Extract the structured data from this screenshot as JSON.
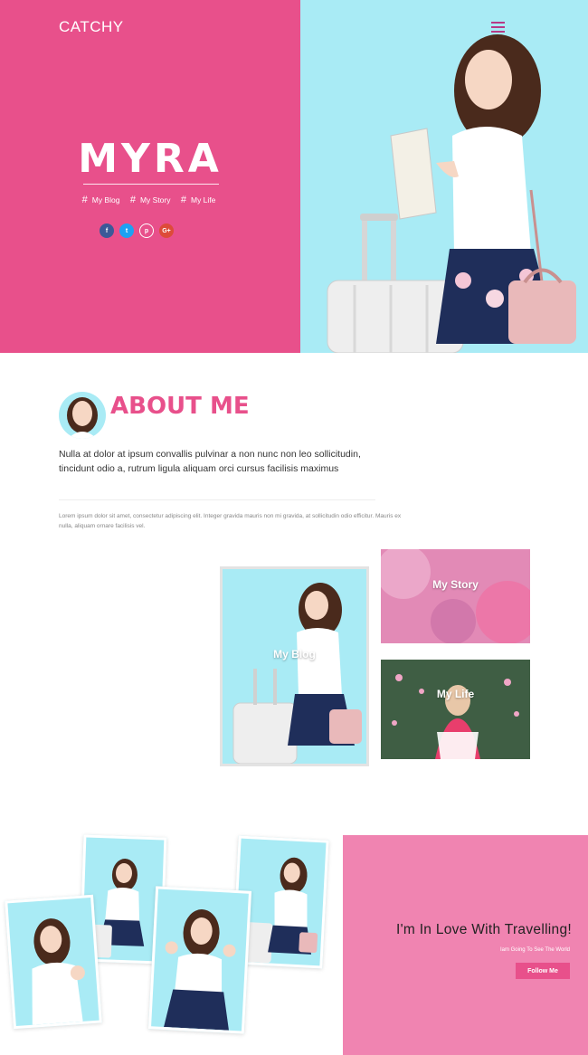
{
  "header": {
    "brand": "CATCHY"
  },
  "hero": {
    "title": "MYRA",
    "tags": [
      "My Blog",
      "My Story",
      "My Life"
    ],
    "socials": [
      {
        "icon": "facebook-icon",
        "glyph": "f",
        "color": "#3b5998"
      },
      {
        "icon": "twitter-icon",
        "glyph": "t",
        "color": "#1da1f2"
      },
      {
        "icon": "pinterest-icon",
        "glyph": "p",
        "color": "#e8508b"
      },
      {
        "icon": "google-plus-icon",
        "glyph": "G+",
        "color": "#dd4b39"
      }
    ]
  },
  "about": {
    "title": "ABOUT ME",
    "lead": "Nulla at dolor at ipsum convallis pulvinar a non nunc non leo sollicitudin, tincidunt odio a, rutrum ligula aliquam orci cursus facilisis maximus",
    "small": "Lorem ipsum dolor sit amet, consectetur adipiscing elit. Integer gravida mauris non mi gravida, at sollicitudin odio efficitur. Mauris ex nulla, aliquam ornare facilisis vel."
  },
  "cards": {
    "blog": "My Blog",
    "story": "My Story",
    "life": "My Life"
  },
  "travel": {
    "title": "I'm In Love With Travelling!",
    "subtitle": "Iam Going To See The World",
    "button": "Follow Me"
  },
  "colors": {
    "primary": "#e8508b",
    "sky": "#a9ebf5",
    "soft_pink": "#f084b1"
  }
}
